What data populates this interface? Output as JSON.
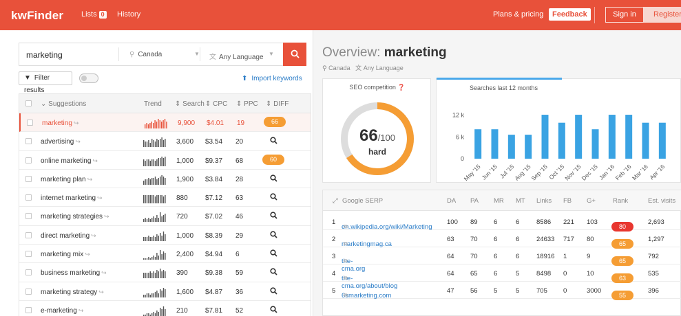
{
  "header": {
    "logo": "kwFinder",
    "nav_lists": "Lists",
    "lists_count": "0",
    "nav_history": "History",
    "plans": "Plans & pricing",
    "feedback": "Feedback",
    "signin": "Sign in",
    "register": "Register",
    "colors": {
      "brand": "#e8513a"
    }
  },
  "search": {
    "query": "marketing",
    "location": "Canada",
    "language": "Any Language",
    "filter_label": "Filter results",
    "import_label": "Import keywords"
  },
  "table": {
    "headers": [
      "Suggestions",
      "Trend",
      "Search",
      "CPC",
      "PPC",
      "DIFF"
    ],
    "rows": [
      {
        "keyword": "marketing",
        "search": "9,900",
        "cpc": "$4.01",
        "ppc": "19",
        "diff": "66",
        "active": true,
        "trend": [
          3,
          4,
          3,
          4,
          5,
          4,
          6,
          5,
          7,
          6,
          5,
          6,
          7,
          5
        ]
      },
      {
        "keyword": "advertising",
        "search": "3,600",
        "cpc": "$3.54",
        "ppc": "20",
        "diff": null,
        "trend": [
          5,
          4,
          4,
          5,
          3,
          6,
          5,
          4,
          6,
          5,
          6,
          7,
          5,
          6
        ]
      },
      {
        "keyword": "online marketing",
        "search": "1,000",
        "cpc": "$9.37",
        "ppc": "68",
        "diff": "60",
        "trend": [
          5,
          4,
          5,
          5,
          4,
          5,
          5,
          4,
          5,
          6,
          6,
          7,
          6,
          7
        ]
      },
      {
        "keyword": "marketing plan",
        "search": "1,900",
        "cpc": "$3.84",
        "ppc": "28",
        "diff": null,
        "trend": [
          3,
          4,
          4,
          5,
          4,
          5,
          5,
          6,
          4,
          5,
          6,
          7,
          6,
          5
        ]
      },
      {
        "keyword": "internet marketing",
        "search": "880",
        "cpc": "$7.12",
        "ppc": "63",
        "diff": null,
        "trend": [
          6,
          6,
          6,
          6,
          6,
          6,
          6,
          5,
          6,
          6,
          6,
          6,
          5,
          6
        ]
      },
      {
        "keyword": "marketing strategies",
        "search": "720",
        "cpc": "$7.02",
        "ppc": "46",
        "diff": null,
        "trend": [
          2,
          3,
          2,
          3,
          2,
          3,
          4,
          3,
          5,
          3,
          7,
          4,
          5,
          6
        ]
      },
      {
        "keyword": "direct marketing",
        "search": "1,000",
        "cpc": "$8.39",
        "ppc": "29",
        "diff": null,
        "trend": [
          3,
          3,
          3,
          4,
          3,
          3,
          4,
          3,
          5,
          4,
          6,
          4,
          7,
          5
        ]
      },
      {
        "keyword": "marketing mix",
        "search": "2,400",
        "cpc": "$4.94",
        "ppc": "6",
        "diff": null,
        "trend": [
          1,
          1,
          1,
          2,
          1,
          2,
          3,
          2,
          5,
          3,
          7,
          4,
          6,
          5
        ]
      },
      {
        "keyword": "business marketing",
        "search": "390",
        "cpc": "$9.38",
        "ppc": "59",
        "diff": null,
        "trend": [
          4,
          4,
          4,
          4,
          5,
          4,
          5,
          4,
          6,
          5,
          7,
          5,
          6,
          5
        ]
      },
      {
        "keyword": "marketing strategy",
        "search": "1,600",
        "cpc": "$4.87",
        "ppc": "36",
        "diff": null,
        "trend": [
          2,
          2,
          3,
          3,
          2,
          3,
          3,
          4,
          5,
          3,
          6,
          5,
          7,
          6
        ]
      },
      {
        "keyword": "e-marketing",
        "search": "210",
        "cpc": "$7.81",
        "ppc": "52",
        "diff": null,
        "trend": [
          1,
          1,
          2,
          2,
          1,
          2,
          3,
          2,
          4,
          3,
          6,
          5,
          7,
          5
        ]
      }
    ]
  },
  "overview": {
    "title_prefix": "Overview:",
    "keyword": "marketing",
    "location": "Canada",
    "language": "Any Language",
    "seo_label": "SEO competition",
    "seo_score": "66",
    "seo_max": "/100",
    "seo_rating": "hard",
    "seo_value": 66,
    "chart_title": "Searches last 12 months"
  },
  "chart_data": {
    "type": "bar",
    "title": "Searches last 12 months",
    "categories": [
      "May '15",
      "Jun '15",
      "Jul '15",
      "Aug '15",
      "Sep '15",
      "Oct '15",
      "Nov '15",
      "Dec '15",
      "Jan '16",
      "Feb '16",
      "Mar '16",
      "Apr '16"
    ],
    "values": [
      8100,
      8100,
      6600,
      6600,
      12100,
      9900,
      12100,
      8100,
      12100,
      12100,
      9900,
      9900
    ],
    "y_ticks": [
      "12 k",
      "6 k",
      "0"
    ],
    "ylim": [
      0,
      14000
    ],
    "color": "#3aa3e3"
  },
  "serp": {
    "headers": [
      "Google SERP",
      "DA",
      "PA",
      "MR",
      "MT",
      "Links",
      "FB",
      "G+",
      "Rank",
      "Est. visits"
    ],
    "rows": [
      {
        "n": "1",
        "url": "en.wikipedia.org/wiki/Marketing",
        "da": "100",
        "pa": "89",
        "mr": "6",
        "mt": "6",
        "links": "8586",
        "fb": "221",
        "gp": "103",
        "rank": "80",
        "visits": "2,693",
        "rank_color": "#e8362f"
      },
      {
        "n": "2",
        "url": "marketingmag.ca",
        "da": "63",
        "pa": "70",
        "mr": "6",
        "mt": "6",
        "links": "24633",
        "fb": "717",
        "gp": "80",
        "rank": "65",
        "visits": "1,297",
        "rank_color": "#f59d34"
      },
      {
        "n": "3",
        "url": "the-cma.org",
        "da": "64",
        "pa": "70",
        "mr": "6",
        "mt": "6",
        "links": "18916",
        "fb": "1",
        "gp": "9",
        "rank": "65",
        "visits": "792",
        "rank_color": "#f59d34"
      },
      {
        "n": "4",
        "url": "the-cma.org/about/blog",
        "da": "64",
        "pa": "65",
        "mr": "6",
        "mt": "5",
        "links": "8498",
        "fb": "0",
        "gp": "10",
        "rank": "63",
        "visits": "535",
        "rank_color": "#f59d34"
      },
      {
        "n": "5",
        "url": "6smarketing.com",
        "da": "47",
        "pa": "56",
        "mr": "5",
        "mt": "5",
        "links": "705",
        "fb": "0",
        "gp": "3000",
        "rank": "55",
        "visits": "396",
        "rank_color": "#f59d34"
      }
    ]
  }
}
